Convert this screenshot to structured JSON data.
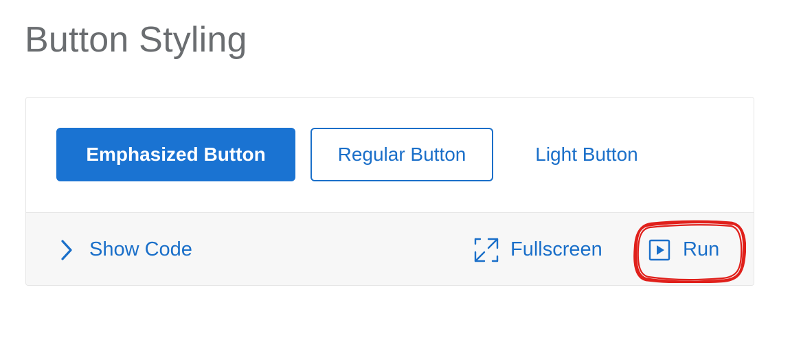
{
  "page": {
    "title": "Button Styling"
  },
  "preview": {
    "buttons": {
      "emphasized": "Emphasized Button",
      "regular": "Regular Button",
      "light": "Light Button"
    }
  },
  "toolbar": {
    "show_code": "Show Code",
    "fullscreen": "Fullscreen",
    "run": "Run"
  },
  "colors": {
    "accent": "#1a73d2",
    "link": "#1a6fc9",
    "title": "#6a6d70",
    "toolbar_bg": "#f7f7f7",
    "highlight": "#e0201b"
  },
  "icons": {
    "show_code": "chevron-right-icon",
    "fullscreen": "fullscreen-icon",
    "run": "play-icon",
    "annotation": "red-scribble-circle-annotation"
  }
}
